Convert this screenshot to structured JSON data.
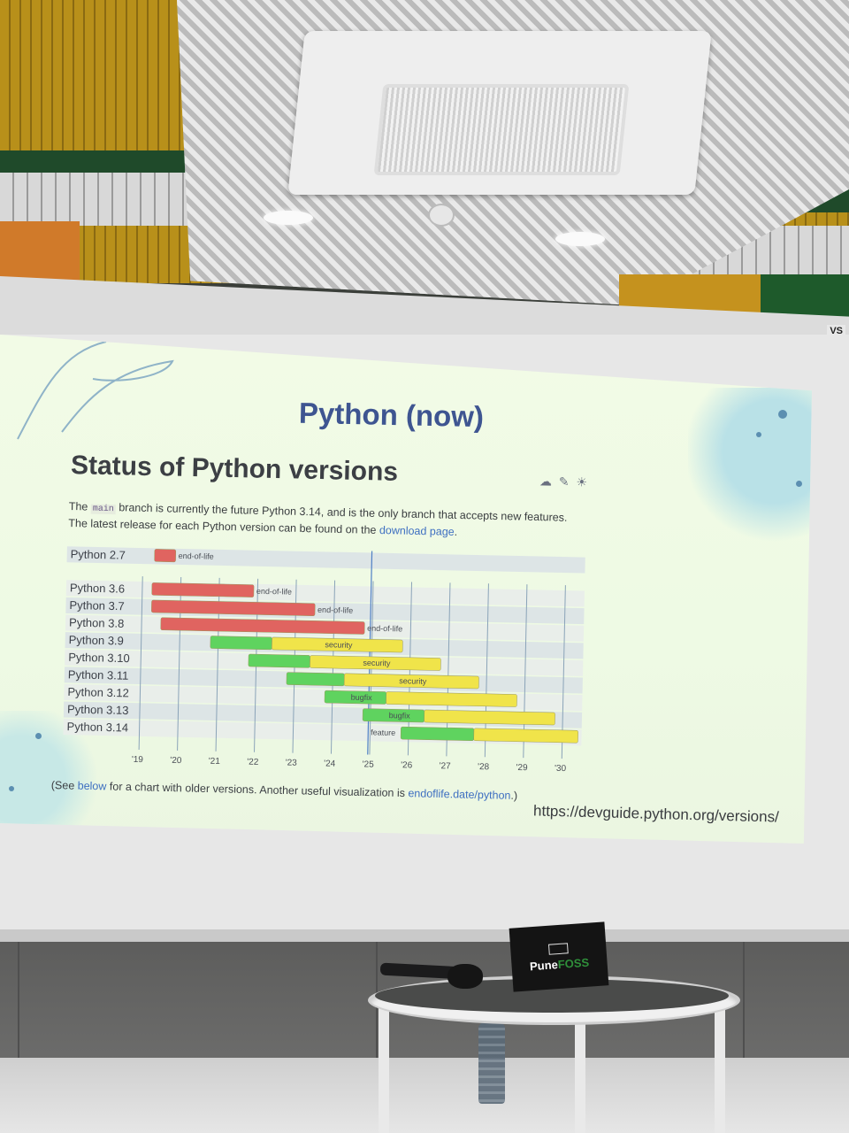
{
  "slide": {
    "title": "Python (now)",
    "heading": "Status of Python versions",
    "heading_icons": "☁ ✎ ☀",
    "desc_line1_pre": "The ",
    "desc_code": "main",
    "desc_line1_post": " branch is currently the future Python 3.14, and is the only branch that accepts new features.",
    "desc_line2_pre": "The latest release for each Python version can be found on the ",
    "desc_link": "download page",
    "desc_line2_post": ".",
    "footnote_pre": "(See ",
    "footnote_link1": "below",
    "footnote_mid": " for a chart with older versions. Another useful visualization is ",
    "footnote_link2": "endoflife.date/python",
    "footnote_post": ".)",
    "url": "https://devguide.python.org/versions/"
  },
  "screen_brand": "VS",
  "name_tent": {
    "name_main": "Pune",
    "name_accent": "FOSS"
  },
  "chart_data": {
    "type": "gantt",
    "x_ticks": [
      "'19",
      "'20",
      "'21",
      "'22",
      "'23",
      "'24",
      "'25",
      "'26",
      "'27",
      "'28",
      "'29",
      "'30"
    ],
    "x_range": [
      2019,
      2030.5
    ],
    "today": 2024.95,
    "colors": {
      "end-of-life": "#e06460",
      "security": "#f0e44a",
      "bugfix": "#5fd35f",
      "feature": "#5fd35f"
    },
    "rows": [
      {
        "version": "Python 2.7",
        "segments": [
          {
            "phase": "end-of-life",
            "start": 2019.3,
            "end": 2019.85
          }
        ],
        "label": "end-of-life"
      },
      {
        "version": "Python 3.6",
        "segments": [
          {
            "phase": "end-of-life",
            "start": 2019.25,
            "end": 2021.9
          }
        ],
        "label": "end-of-life"
      },
      {
        "version": "Python 3.7",
        "segments": [
          {
            "phase": "end-of-life",
            "start": 2019.25,
            "end": 2023.5
          }
        ],
        "label": "end-of-life"
      },
      {
        "version": "Python 3.8",
        "segments": [
          {
            "phase": "end-of-life",
            "start": 2019.5,
            "end": 2024.8
          }
        ],
        "label": "end-of-life"
      },
      {
        "version": "Python 3.9",
        "segments": [
          {
            "phase": "bugfix",
            "start": 2020.8,
            "end": 2022.4
          },
          {
            "phase": "security",
            "start": 2022.4,
            "end": 2025.8
          }
        ],
        "label": "security"
      },
      {
        "version": "Python 3.10",
        "segments": [
          {
            "phase": "bugfix",
            "start": 2021.8,
            "end": 2023.4
          },
          {
            "phase": "security",
            "start": 2023.4,
            "end": 2026.8
          }
        ],
        "label": "security"
      },
      {
        "version": "Python 3.11",
        "segments": [
          {
            "phase": "bugfix",
            "start": 2022.8,
            "end": 2024.3
          },
          {
            "phase": "security",
            "start": 2024.3,
            "end": 2027.8
          }
        ],
        "label": "security"
      },
      {
        "version": "Python 3.12",
        "segments": [
          {
            "phase": "bugfix",
            "start": 2023.8,
            "end": 2025.4
          },
          {
            "phase": "security",
            "start": 2025.4,
            "end": 2028.8
          }
        ],
        "label": "bugfix"
      },
      {
        "version": "Python 3.13",
        "segments": [
          {
            "phase": "bugfix",
            "start": 2024.8,
            "end": 2026.4
          },
          {
            "phase": "security",
            "start": 2026.4,
            "end": 2029.8
          }
        ],
        "label": "bugfix"
      },
      {
        "version": "Python 3.14",
        "segments": [
          {
            "phase": "feature",
            "start": 2025.8,
            "end": 2027.7
          },
          {
            "phase": "security",
            "start": 2027.7,
            "end": 2030.8
          }
        ],
        "label": "feature"
      }
    ]
  }
}
